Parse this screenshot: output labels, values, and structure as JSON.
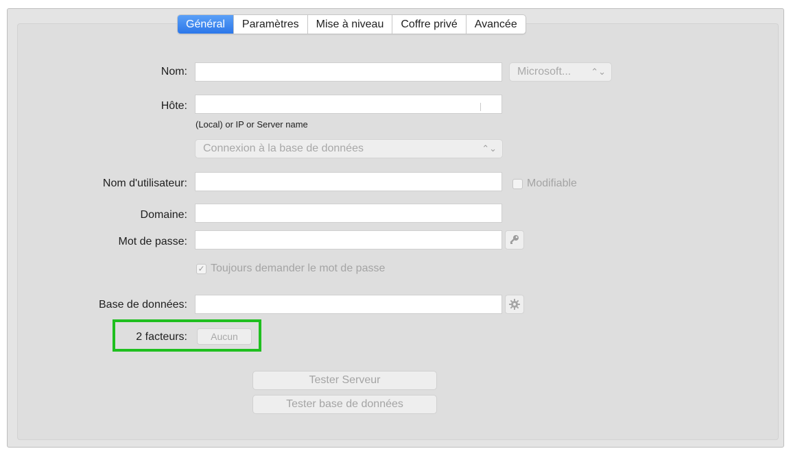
{
  "tabs": [
    {
      "label": "Général",
      "active": true
    },
    {
      "label": "Paramètres",
      "active": false
    },
    {
      "label": "Mise à niveau",
      "active": false
    },
    {
      "label": "Coffre privé",
      "active": false
    },
    {
      "label": "Avancée",
      "active": false
    }
  ],
  "form": {
    "name_label": "Nom:",
    "name_value": "",
    "type_select": "Microsoft...",
    "host_label": "Hôte:",
    "host_value": "",
    "host_hint": "(Local) or IP or Server name",
    "connection_select": "Connexion à la base de données",
    "username_label": "Nom d'utilisateur:",
    "username_value": "",
    "modifiable_label": "Modifiable",
    "modifiable_checked": false,
    "domain_label": "Domaine:",
    "domain_value": "",
    "password_label": "Mot de passe:",
    "password_value": "",
    "always_ask_label": "Toujours demander le mot de passe",
    "always_ask_checked": true,
    "database_label": "Base de données:",
    "database_value": "",
    "two_factor_label": "2 facteurs:",
    "two_factor_button": "Aucun"
  },
  "actions": {
    "test_server": "Tester Serveur",
    "test_database": "Tester base de données"
  },
  "icons": {
    "password_button": "key-icon",
    "database_button": "gear-icon"
  },
  "colors": {
    "active_tab": "#2c77e9",
    "highlight": "#1fbf1f"
  }
}
